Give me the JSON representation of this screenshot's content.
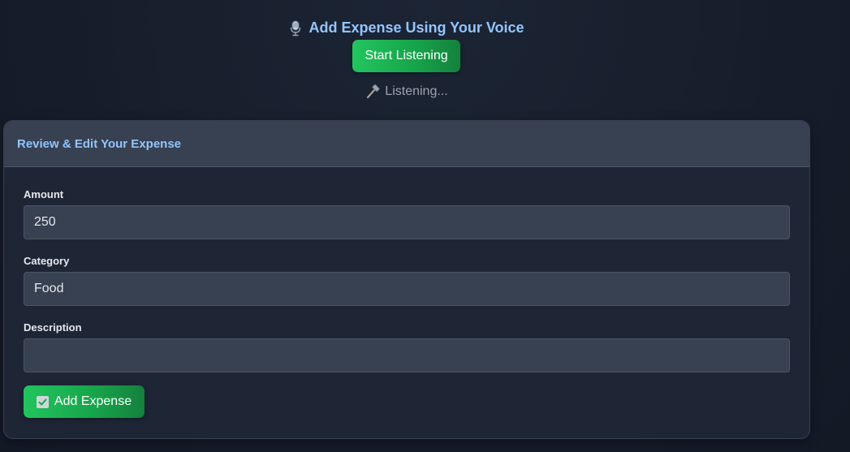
{
  "voice": {
    "title": "Add Expense Using Your Voice",
    "title_icon": "microphone-icon",
    "start_button_label": "Start Listening",
    "status_text": "Listening...",
    "status_icon": "hammer-icon"
  },
  "card": {
    "header": "Review & Edit Your Expense",
    "fields": {
      "amount": {
        "label": "Amount",
        "value": "250"
      },
      "category": {
        "label": "Category",
        "value": "Food"
      },
      "description": {
        "label": "Description",
        "value": ""
      }
    },
    "submit_label": "Add Expense",
    "submit_icon": "checkbox-check-icon"
  },
  "colors": {
    "accent_text": "#93c5fd",
    "button_green": "#22c55e",
    "card_bg": "#1e2636",
    "input_bg": "#374151"
  }
}
